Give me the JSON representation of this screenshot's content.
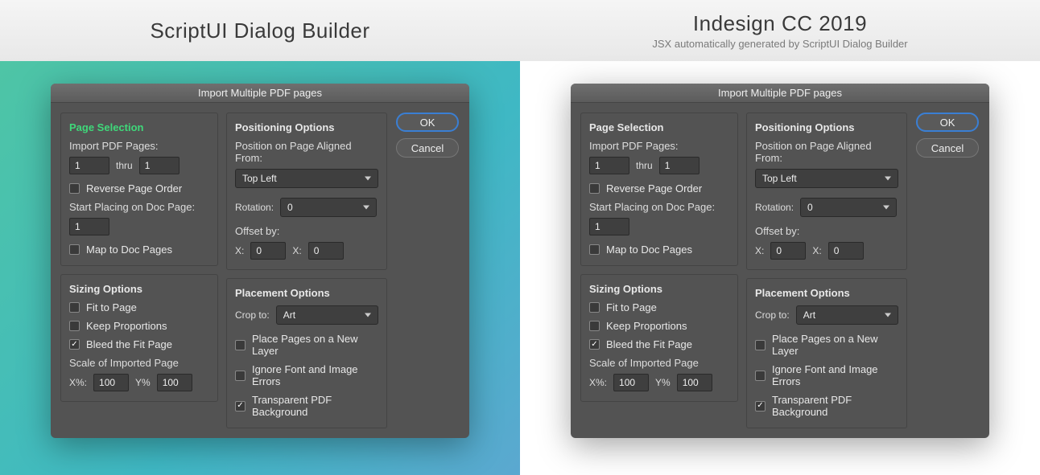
{
  "header": {
    "left_title": "ScriptUI Dialog Builder",
    "right_title": "Indesign CC 2019",
    "right_subtitle": "JSX automatically generated by ScriptUI Dialog Builder"
  },
  "dialog": {
    "title": "Import Multiple PDF pages",
    "page_selection": {
      "title": "Page Selection",
      "import_label": "Import PDF Pages:",
      "from_value": "1",
      "thru_label": "thru",
      "to_value": "1",
      "reverse_label": "Reverse Page Order",
      "start_placing_label": "Start Placing on Doc Page:",
      "start_value": "1",
      "map_label": "Map to Doc Pages"
    },
    "positioning": {
      "title": "Positioning Options",
      "position_label": "Position on Page Aligned From:",
      "position_value": "Top Left",
      "rotation_label": "Rotation:",
      "rotation_value": "0",
      "offset_label": "Offset by:",
      "x_label": "X:",
      "x_value": "0",
      "x2_label": "X:",
      "x2_value": "0"
    },
    "positioning_right": {
      "x2_label": "X:"
    },
    "sizing": {
      "title": "Sizing Options",
      "fit_label": "Fit to Page",
      "keep_label": "Keep Proportions",
      "bleed_label": "Bleed the Fit Page",
      "scale_label": "Scale of Imported Page",
      "xpct_label": "X%:",
      "xpct_value": "100",
      "ypct_label": "Y%",
      "ypct_value": "100"
    },
    "placement": {
      "title": "Placement Options",
      "crop_label": "Crop to:",
      "crop_value": "Art",
      "new_layer_label": "Place Pages on a New Layer",
      "ignore_label": "Ignore Font and Image Errors",
      "transparent_label": "Transparent PDF Background"
    },
    "buttons": {
      "ok": "OK",
      "cancel": "Cancel"
    }
  }
}
